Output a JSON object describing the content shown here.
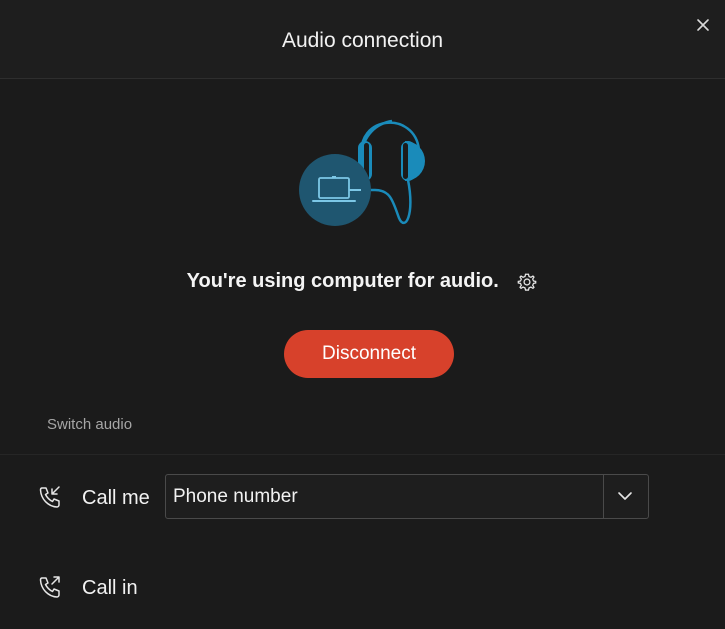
{
  "window": {
    "title": "Audio connection",
    "close_icon": "close-icon"
  },
  "status": {
    "message": "You're using computer for audio.",
    "settings_icon": "gear-icon"
  },
  "actions": {
    "disconnect_label": "Disconnect",
    "disconnect_color": "#d7412b"
  },
  "switch_audio": {
    "section_label": "Switch audio",
    "call_me": {
      "label": "Call me",
      "icon": "phone-incoming-icon",
      "field_placeholder": "Phone number",
      "dropdown_icon": "chevron-down-icon"
    },
    "call_in": {
      "label": "Call in",
      "icon": "phone-outgoing-icon"
    }
  },
  "colors": {
    "background": "#1b1b1b",
    "accent_blue": "#1a8bba",
    "circle_blue": "#1f5670"
  }
}
